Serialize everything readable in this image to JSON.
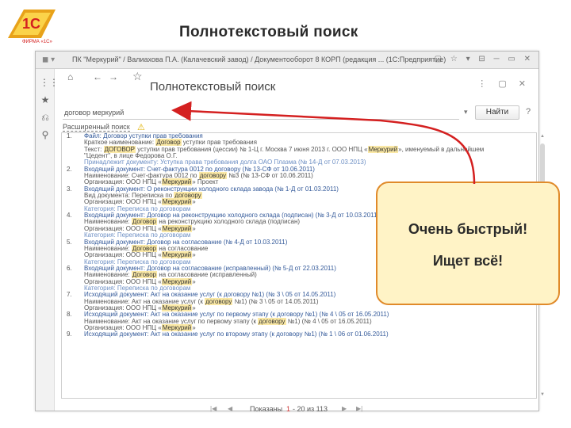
{
  "slide": {
    "title": "Полнотекстовый поиск",
    "logo_text": "1С",
    "logo_caption": "ФИРМА «1С»"
  },
  "window": {
    "titlebar": "ПК \"Меркурий\" / Валиахова П.А. (Калачевский завод) / Документооборот 8 КОРП (редакция ... (1С:Предприятие)",
    "form_title": "Полнотекстовый поиск",
    "search": {
      "value": "договор меркурий",
      "find_label": "Найти",
      "help_label": "?"
    },
    "options_link": "Расширенный поиск",
    "pager": {
      "label": "Показаны",
      "current": "1",
      "range": "- 20 из 113"
    }
  },
  "results": [
    {
      "num": "1.",
      "lines": [
        {
          "k": "title",
          "parts": [
            "Файл: Договор уступки прав требования"
          ]
        },
        {
          "k": "line",
          "parts": [
            "Краткое наименование: ",
            "Договор",
            " уступки прав требования"
          ]
        },
        {
          "k": "line",
          "parts": [
            "Текст: ",
            "ДОГОВОР",
            " уступки прав требования (цессии) № 1-Ц г. Москва 7 июня 2013 г. ООО НПЦ «",
            "Меркурий",
            "», именуемый в дальнейшем"
          ]
        },
        {
          "k": "line",
          "parts": [
            "\"Цедент\", в лице Федорова О.Г."
          ]
        },
        {
          "k": "cat",
          "parts": [
            "Принадлежит документу: Уступка права требования долга ОАО Плазма (№ 14-Д от 07.03.2013)"
          ]
        }
      ]
    },
    {
      "num": "2.",
      "lines": [
        {
          "k": "title",
          "parts": [
            "Входящий документ: Счет-фактура 0012 по договору (№ 13-СФ от 10.06.2011)"
          ]
        },
        {
          "k": "line",
          "parts": [
            "Наименование: Счет-фактура 0012 по ",
            "договору",
            " №3 (№ 13-СФ от 10.06.2011)"
          ]
        },
        {
          "k": "line",
          "parts": [
            "Организация: ООО НПЦ «",
            "Меркурий",
            "» Проект"
          ]
        }
      ]
    },
    {
      "num": "3.",
      "lines": [
        {
          "k": "title",
          "parts": [
            "Входящий документ: О реконструкции холодного склада завода (№ 1-Д от 01.03.2011)"
          ]
        },
        {
          "k": "line",
          "parts": [
            "Вид документа: Переписка по ",
            "договору"
          ]
        },
        {
          "k": "line",
          "parts": [
            "Организация: ООО НПЦ «",
            "Меркурий",
            "»"
          ]
        },
        {
          "k": "cat",
          "parts": [
            "Категория: Переписка по договорам"
          ]
        }
      ]
    },
    {
      "num": "4.",
      "lines": [
        {
          "k": "title",
          "parts": [
            "Входящий документ: Договор на реконструкцию холодного склада (подписан) (№ 3-Д от 10.03.2011)"
          ]
        },
        {
          "k": "line",
          "parts": [
            "Наименование: ",
            "Договор",
            " на реконструкцию холодного склада (подписан)"
          ]
        },
        {
          "k": "line",
          "parts": [
            "Организация: ООО НПЦ «",
            "Меркурий",
            "»"
          ]
        },
        {
          "k": "cat",
          "parts": [
            "Категория: Переписка по договорам"
          ]
        }
      ]
    },
    {
      "num": "5.",
      "lines": [
        {
          "k": "title",
          "parts": [
            "Входящий документ: Договор на согласование (№ 4-Д от 10.03.2011)"
          ]
        },
        {
          "k": "line",
          "parts": [
            "Наименование: ",
            "Договор",
            " на согласование"
          ]
        },
        {
          "k": "line",
          "parts": [
            "Организация: ООО НПЦ «",
            "Меркурий",
            "»"
          ]
        },
        {
          "k": "cat",
          "parts": [
            "Категория: Переписка по договорам"
          ]
        }
      ]
    },
    {
      "num": "6.",
      "lines": [
        {
          "k": "title",
          "parts": [
            "Входящий документ: Договор на согласование (исправленный) (№ 5-Д от 22.03.2011)"
          ]
        },
        {
          "k": "line",
          "parts": [
            "Наименование: ",
            "Договор",
            " на согласование (исправленный)"
          ]
        },
        {
          "k": "line",
          "parts": [
            "Организация: ООО НПЦ «",
            "Меркурий",
            "»"
          ]
        },
        {
          "k": "cat",
          "parts": [
            "Категория: Переписка по договорам"
          ]
        }
      ]
    },
    {
      "num": "7.",
      "lines": [
        {
          "k": "title",
          "parts": [
            "Исходящий документ: Акт на оказание услуг (к договору №1) (№ 3 \\ 05 от 14.05.2011)"
          ]
        },
        {
          "k": "line",
          "parts": [
            "Наименование: Акт на оказание услуг (к ",
            "договору",
            " №1) (№ 3 \\ 05 от 14.05.2011)"
          ]
        },
        {
          "k": "line",
          "parts": [
            "Организация: ООО НПЦ «",
            "Меркурий",
            "»"
          ]
        }
      ]
    },
    {
      "num": "8.",
      "lines": [
        {
          "k": "title",
          "parts": [
            "Исходящий документ: Акт на оказание услуг по первому этапу (к договору №1) (№ 4 \\ 05 от 16.05.2011)"
          ]
        },
        {
          "k": "line",
          "parts": [
            "Наименование: Акт на оказание услуг по первому этапу (к ",
            "договору",
            " №1) (№ 4 \\ 05 от 16.05.2011)"
          ]
        },
        {
          "k": "line",
          "parts": [
            "Организация: ООО НПЦ «",
            "Меркурий",
            "»"
          ]
        }
      ]
    },
    {
      "num": "9.",
      "lines": [
        {
          "k": "title",
          "parts": [
            "Исходящий документ: Акт на оказание услуг по второму этапу (к договору №1) (№ 1 \\ 06 от 01.06.2011)"
          ]
        }
      ]
    }
  ],
  "callout": {
    "line1": "Очень быстрый!",
    "line2": "Ищет всё!"
  },
  "colors": {
    "highlight": "#fbe9a6",
    "result_title": "#345a9a",
    "callout_border": "#e08a2a",
    "callout_fill": "#fff3c6"
  }
}
